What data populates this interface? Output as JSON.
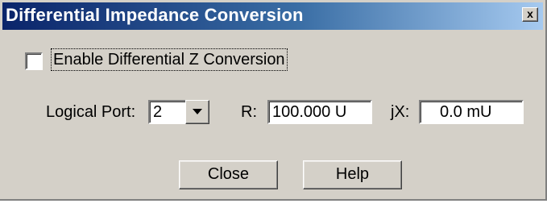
{
  "window": {
    "title": "Differential Impedance Conversion",
    "close_glyph": "x"
  },
  "enable": {
    "label": "Enable Differential Z Conversion",
    "checked": false
  },
  "port": {
    "label": "Logical Port:",
    "value": "2"
  },
  "resistance": {
    "label": "R:",
    "value": "100.000 U"
  },
  "reactance": {
    "label": "jX:",
    "value": "0.0 mU"
  },
  "buttons": {
    "close_label": "Close",
    "help_label": "Help"
  },
  "colors": {
    "title_start": "#0a246a",
    "title_end": "#a6caf0",
    "dialog_bg": "#d4d0c8"
  }
}
